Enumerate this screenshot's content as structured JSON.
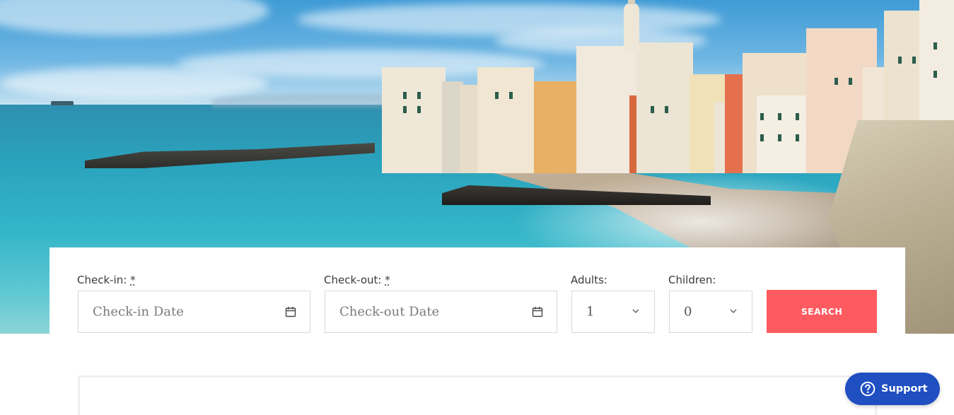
{
  "hero": {
    "scene": "coastal-village-photo"
  },
  "booking": {
    "checkin": {
      "label": "Check-in:",
      "required_mark": "*",
      "placeholder": "Check-in Date",
      "icon": "calendar-icon"
    },
    "checkout": {
      "label": "Check-out:",
      "required_mark": "*",
      "placeholder": "Check-out Date",
      "icon": "calendar-icon"
    },
    "adults": {
      "label": "Adults:",
      "value": "1",
      "icon": "chevron-down-icon"
    },
    "children": {
      "label": "Children:",
      "value": "0",
      "icon": "chevron-down-icon"
    },
    "search_label": "SEARCH"
  },
  "support": {
    "label": "Support",
    "icon": "question-circle-icon"
  },
  "colors": {
    "accent": "#fe5b61",
    "support": "#1f4fc1",
    "border": "#d9d9d9",
    "text": "#3a3a3a"
  }
}
